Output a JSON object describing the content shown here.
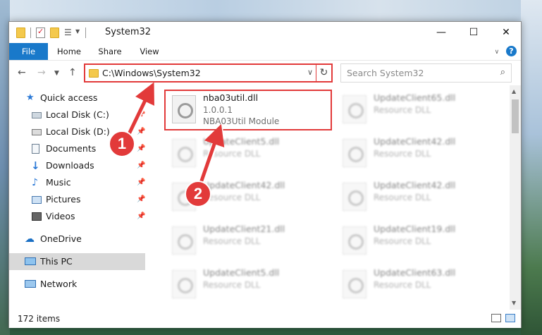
{
  "window": {
    "title": "System32"
  },
  "ribbon": {
    "tabs": [
      "File",
      "Home",
      "Share",
      "View"
    ]
  },
  "address": {
    "path": "C:\\Windows\\System32",
    "search_placeholder": "Search System32"
  },
  "sidebar": {
    "items": [
      {
        "label": "Quick access"
      },
      {
        "label": "Local Disk (C:)"
      },
      {
        "label": "Local Disk (D:)"
      },
      {
        "label": "Documents"
      },
      {
        "label": "Downloads"
      },
      {
        "label": "Music"
      },
      {
        "label": "Pictures"
      },
      {
        "label": "Videos"
      },
      {
        "label": "OneDrive"
      },
      {
        "label": "This PC"
      },
      {
        "label": "Network"
      }
    ]
  },
  "files": {
    "main": {
      "name": "nba03util.dll",
      "version": "1.0.0.1",
      "description": "NBA03Util Module"
    },
    "others": [
      {
        "name": "UpdateClient65.dll",
        "desc": "Resource DLL"
      },
      {
        "name": "UpdateClient5.dll",
        "desc": "Resource DLL"
      },
      {
        "name": "UpdateClient42.dll",
        "desc": "Resource DLL"
      },
      {
        "name": "UpdateClient42.dll",
        "desc": "Resource DLL"
      },
      {
        "name": "UpdateClient42.dll",
        "desc": "Resource DLL"
      },
      {
        "name": "UpdateClient21.dll",
        "desc": "Resource DLL"
      },
      {
        "name": "UpdateClient19.dll",
        "desc": "Resource DLL"
      },
      {
        "name": "UpdateClient5.dll",
        "desc": "Resource DLL"
      },
      {
        "name": "UpdateClient63.dll",
        "desc": "Resource DLL"
      }
    ]
  },
  "status": {
    "count": "172 items"
  },
  "annotations": {
    "step1": "1",
    "step2": "2"
  },
  "colors": {
    "accent": "#1979ca",
    "highlight": "#e23a3a"
  }
}
